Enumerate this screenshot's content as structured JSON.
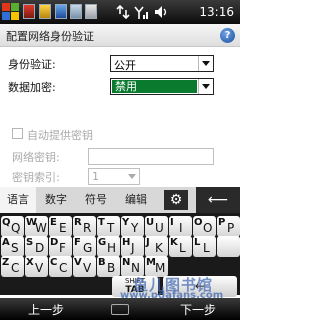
{
  "statusbar": {
    "time": "13:16",
    "icons": [
      "start-logo-icon",
      "app-tile-icon",
      "app-tile-icon",
      "network-icon",
      "signal-bars-icon",
      "volume-icon"
    ]
  },
  "title": {
    "text": "配置网络身份验证",
    "help_label": "?"
  },
  "form": {
    "auth_label": "身份验证:",
    "auth_value": "公开",
    "encryption_label": "数据加密:",
    "encryption_value": "禁用",
    "auto_key_label": "自动提供密钥",
    "network_key_label": "网络密钥:",
    "network_key_value": "",
    "key_index_label": "密钥索引:",
    "key_index_value": "1"
  },
  "keyboard": {
    "tabs": [
      "语言",
      "数字",
      "符号",
      "编辑"
    ],
    "active_tab": "语言",
    "rows": [
      [
        [
          "Q",
          "Q"
        ],
        [
          "W",
          "W"
        ],
        [
          "E",
          "E"
        ],
        [
          "R",
          "R"
        ],
        [
          "T",
          "T"
        ],
        [
          "Y",
          "Y"
        ],
        [
          "U",
          "U"
        ],
        [
          "I",
          "I"
        ],
        [
          "O",
          "O"
        ],
        [
          "P",
          "P"
        ]
      ],
      [
        [
          "A",
          "S"
        ],
        [
          "S",
          "D"
        ],
        [
          "D",
          "F"
        ],
        [
          "F",
          "G"
        ],
        [
          "G",
          "H"
        ],
        [
          "H",
          "J"
        ],
        [
          "J",
          "K"
        ],
        [
          "K",
          "L"
        ],
        [
          "L",
          "L"
        ],
        [
          "",
          ""
        ]
      ],
      [
        [
          "Z",
          "C"
        ],
        [
          "X",
          "V"
        ],
        [
          "C",
          "C"
        ],
        [
          "V",
          "V"
        ],
        [
          "B",
          "B"
        ],
        [
          "N",
          "N"
        ],
        [
          "M",
          "M"
        ]
      ]
    ],
    "shift_line1": "SHIFT",
    "shift_line2": "TAB",
    "enter_label": "←"
  },
  "softkeys": {
    "left": "上一步",
    "right": "下一步"
  },
  "watermark": {
    "line1": "鱼儿图书馆",
    "line2": "www.pdafans.com"
  },
  "colors": {
    "highlight": "#0a7a2e",
    "status_bg": "#0c0c0c"
  }
}
